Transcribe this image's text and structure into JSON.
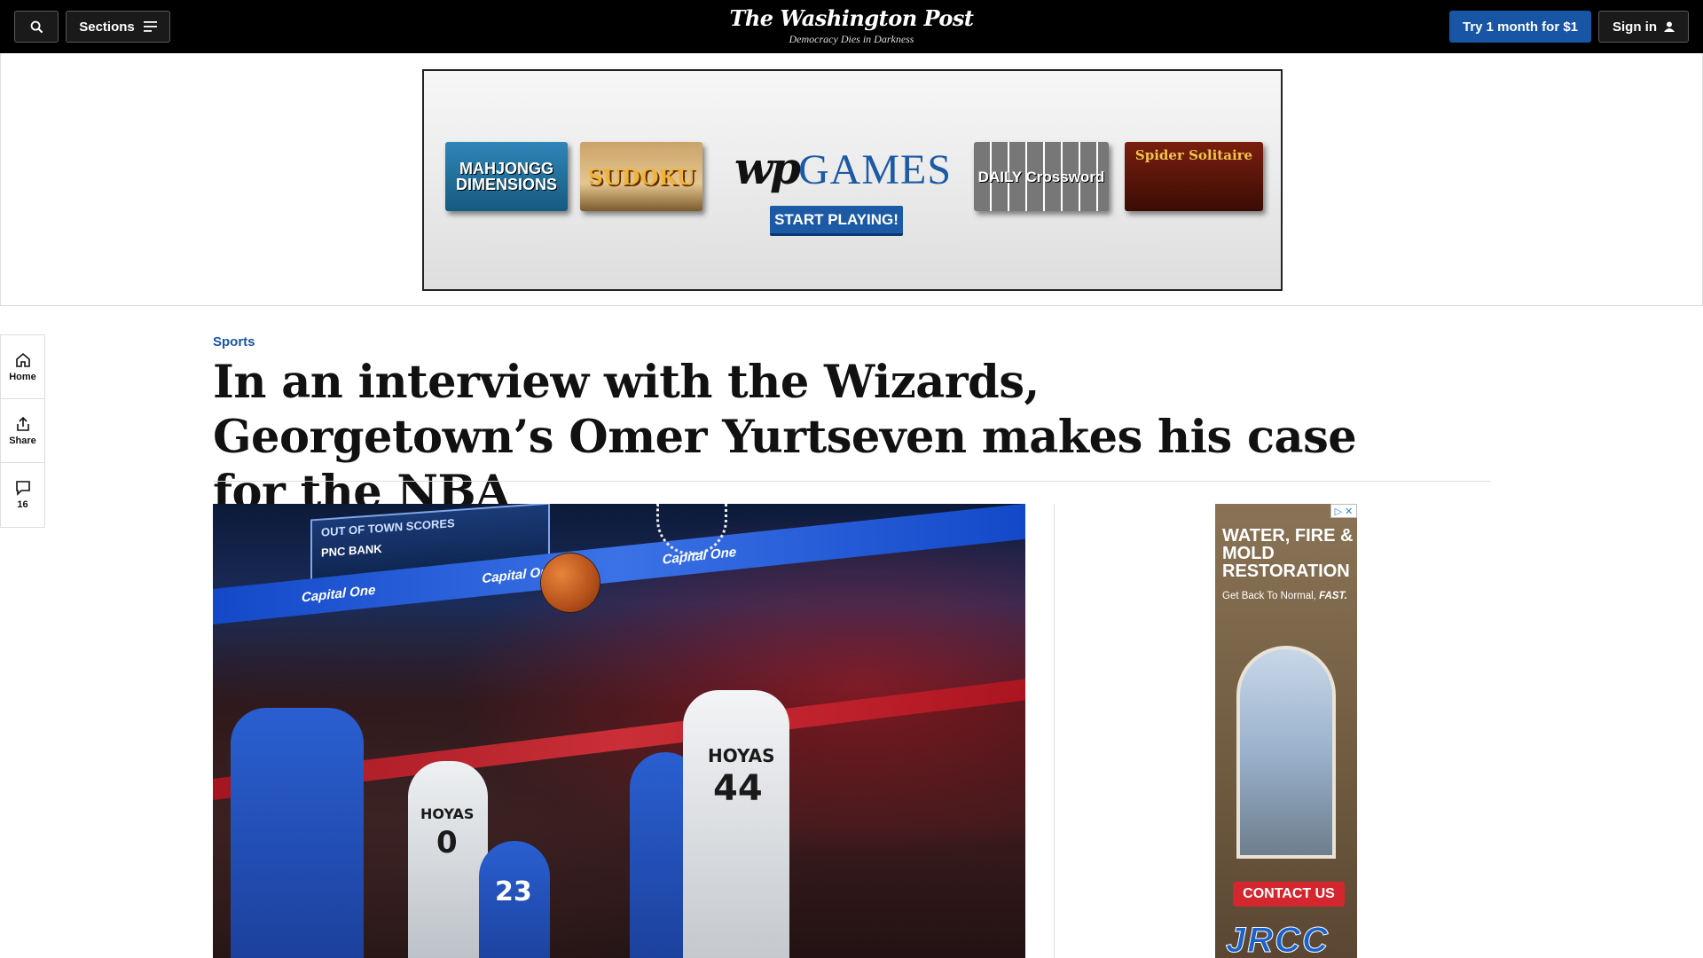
{
  "nav": {
    "search_icon": "search-icon",
    "sections_label": "Sections",
    "logo": "The Washington Post",
    "tagline": "Democracy Dies in Darkness",
    "subscribe_label": "Try 1 month for $1",
    "signin_label": "Sign in",
    "accent_color": "#1955a5"
  },
  "banner_ad": {
    "tiles": [
      "MAHJONGG DIMENSIONS",
      "SUDOKU",
      "DAILY Crossword",
      "Spider Solitaire"
    ],
    "brand_mark": "wp",
    "brand_word": "GAMES",
    "cta": "START PLAYING!"
  },
  "rail": {
    "home_label": "Home",
    "share_label": "Share",
    "comments_count": "16"
  },
  "article": {
    "kicker": "Sports",
    "headline": "In an interview with the Wizards, Georgetown’s Omer Yurtseven makes his case for the NBA"
  },
  "photo": {
    "scoreboard_title": "OUT OF TOWN SCORES",
    "scoreboard_sponsor": "PNC BANK",
    "band_text": "Capital One",
    "jersey_team": "HOYAS",
    "jersey_numbers": [
      "0",
      "44",
      "23"
    ]
  },
  "side_ad": {
    "headline": "WATER, FIRE & MOLD RESTORATION",
    "sub_prefix": "Get Back To Normal,",
    "sub_emphasis": "FAST.",
    "cta": "CONTACT US",
    "logo": "JRCC"
  }
}
